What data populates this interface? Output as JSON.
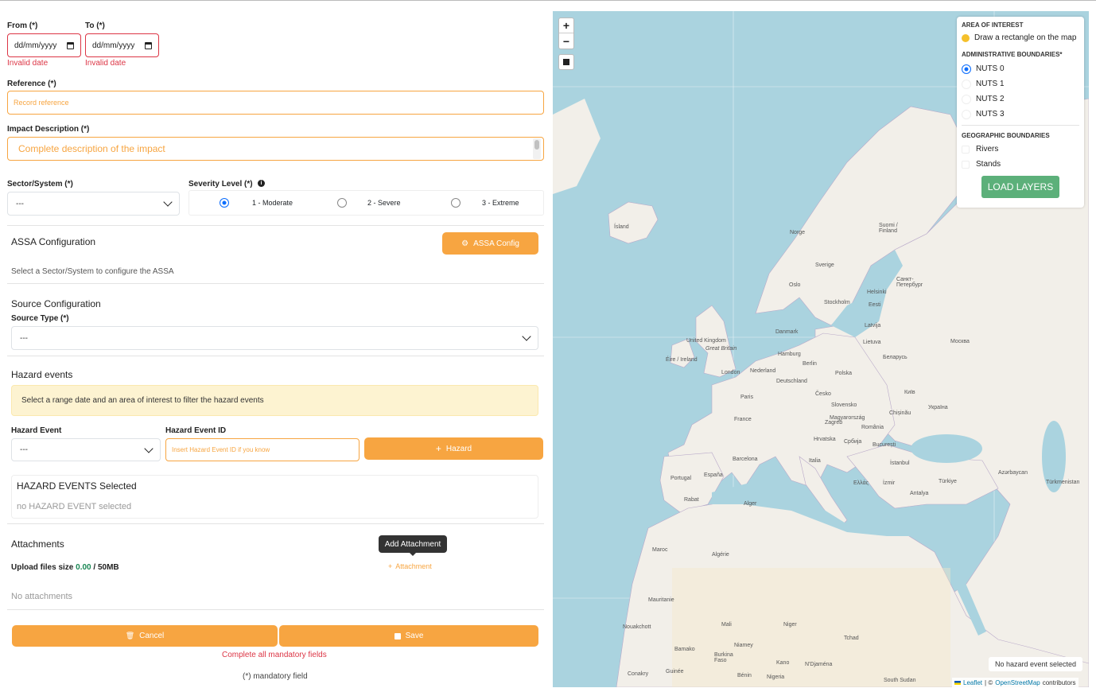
{
  "form": {
    "from_label": "From (*)",
    "to_label": "To (*)",
    "date_placeholder": "dd/mm/yyyy",
    "invalid_date": "Invalid date",
    "reference_label": "Reference (*)",
    "reference_placeholder": "Record reference",
    "impact_label": "Impact Description (*)",
    "impact_placeholder": "Complete description of the impact",
    "sector_label": "Sector/System (*)",
    "sector_value": "---",
    "severity_label": "Severity Level (*)",
    "severity_options": [
      "1 - Moderate",
      "2 - Severe",
      "3 - Extreme"
    ],
    "severity_selected": "1 - Moderate"
  },
  "assa": {
    "title": "ASSA Configuration",
    "button": "ASSA Config",
    "hint": "Select a Sector/System to configure the ASSA"
  },
  "source": {
    "title": "Source Configuration",
    "type_label": "Source Type (*)",
    "type_value": "---"
  },
  "hazard": {
    "title": "Hazard events",
    "alert": "Select a range date and an area of interest to filter the hazard events",
    "event_label": "Hazard Event",
    "event_value": "---",
    "id_label": "Hazard Event ID",
    "id_placeholder": "Insert Hazard Event ID if you know",
    "add_button": "Hazard",
    "selected_title": "HAZARD EVENTS Selected",
    "selected_empty": "no HAZARD EVENT selected"
  },
  "attachments": {
    "title": "Attachments",
    "size_label": "Upload files size",
    "size_used": "0.00",
    "size_limit": "/ 50MB",
    "tooltip": "Add Attachment",
    "add_button": "Attachment",
    "empty": "No attachments"
  },
  "footer": {
    "cancel": "Cancel",
    "save": "Save",
    "error": "Complete all mandatory fields",
    "mandatory_note": "(*) mandatory field"
  },
  "map": {
    "zoom_in": "+",
    "zoom_out": "−",
    "panel": {
      "area_title": "AREA OF INTEREST",
      "area_item": "Draw a rectangle on the map",
      "admin_title": "ADMINISTRATIVE BOUNDARIES*",
      "admin_options": [
        "NUTS 0",
        "NUTS 1",
        "NUTS 2",
        "NUTS 3"
      ],
      "admin_selected": "NUTS 0",
      "geo_title": "GEOGRAPHIC BOUNDARIES",
      "geo_options": [
        "Rivers",
        "Stands"
      ],
      "load_button": "LOAD LAYERS"
    },
    "no_hazard": "No hazard event selected",
    "attribution_leaflet": "Leaflet",
    "attribution_sep": "| ©",
    "attribution_osm": "OpenStreetMap",
    "attribution_tail": "contributors",
    "labels": {
      "island": "Ísland",
      "norge": "Norge",
      "sverige": "Sverige",
      "suomi": "Suomi / Finland",
      "oslo": "Oslo",
      "stockholm": "Stockholm",
      "helsinki": "Helsinki",
      "spb": "Санкт-Петербург",
      "eesti": "Eesti",
      "latvija": "Latvija",
      "lietuva": "Lietuva",
      "moskva": "Москва",
      "danmark": "Danmark",
      "uk": "United Kingdom",
      "gb": "Great Britain",
      "eire": "Éire / Ireland",
      "london": "London",
      "nederland": "Nederland",
      "hamburg": "Hamburg",
      "berlin": "Berlin",
      "polska": "Polska",
      "belarus": "Беларусь",
      "deutschland": "Deutschland",
      "paris": "Paris",
      "cesko": "Česko",
      "slovensko": "Slovensko",
      "kyiv": "Київ",
      "ukraina": "Україна",
      "france": "France",
      "magyar": "Magyarország",
      "chisinau": "Chișinău",
      "zagreb": "Zagreb",
      "hrvatska": "Hrvatska",
      "srbija": "Србија",
      "romania": "România",
      "bucuresti": "București",
      "italia": "Italia",
      "barcelona": "Barcelona",
      "istanbul": "İstanbul",
      "portugal": "Portugal",
      "espana": "España",
      "ellas": "Ελλάς",
      "izmir": "İzmir",
      "turkiye": "Türkiye",
      "antalya": "Antalya",
      "rabat": "Rabat",
      "alger": "Alger",
      "maroc": "Maroc",
      "algerie": "Algérie",
      "mauritanie": "Mauritanie",
      "mali": "Mali",
      "niger": "Niger",
      "tchad": "Tchad",
      "nouakchott": "Nouakchott",
      "bamako": "Bamako",
      "niamey": "Niamey",
      "burkina": "Burkina Faso",
      "kano": "Kano",
      "ndjamena": "N'Djaména",
      "nigeria": "Nigeria",
      "benin": "Bénin",
      "guinee": "Guinée",
      "conakry": "Conakry",
      "south_sudan": "South Sudan",
      "turkmenistan": "Türkmenistan",
      "azerbaycan": "Azərbaycan"
    }
  }
}
